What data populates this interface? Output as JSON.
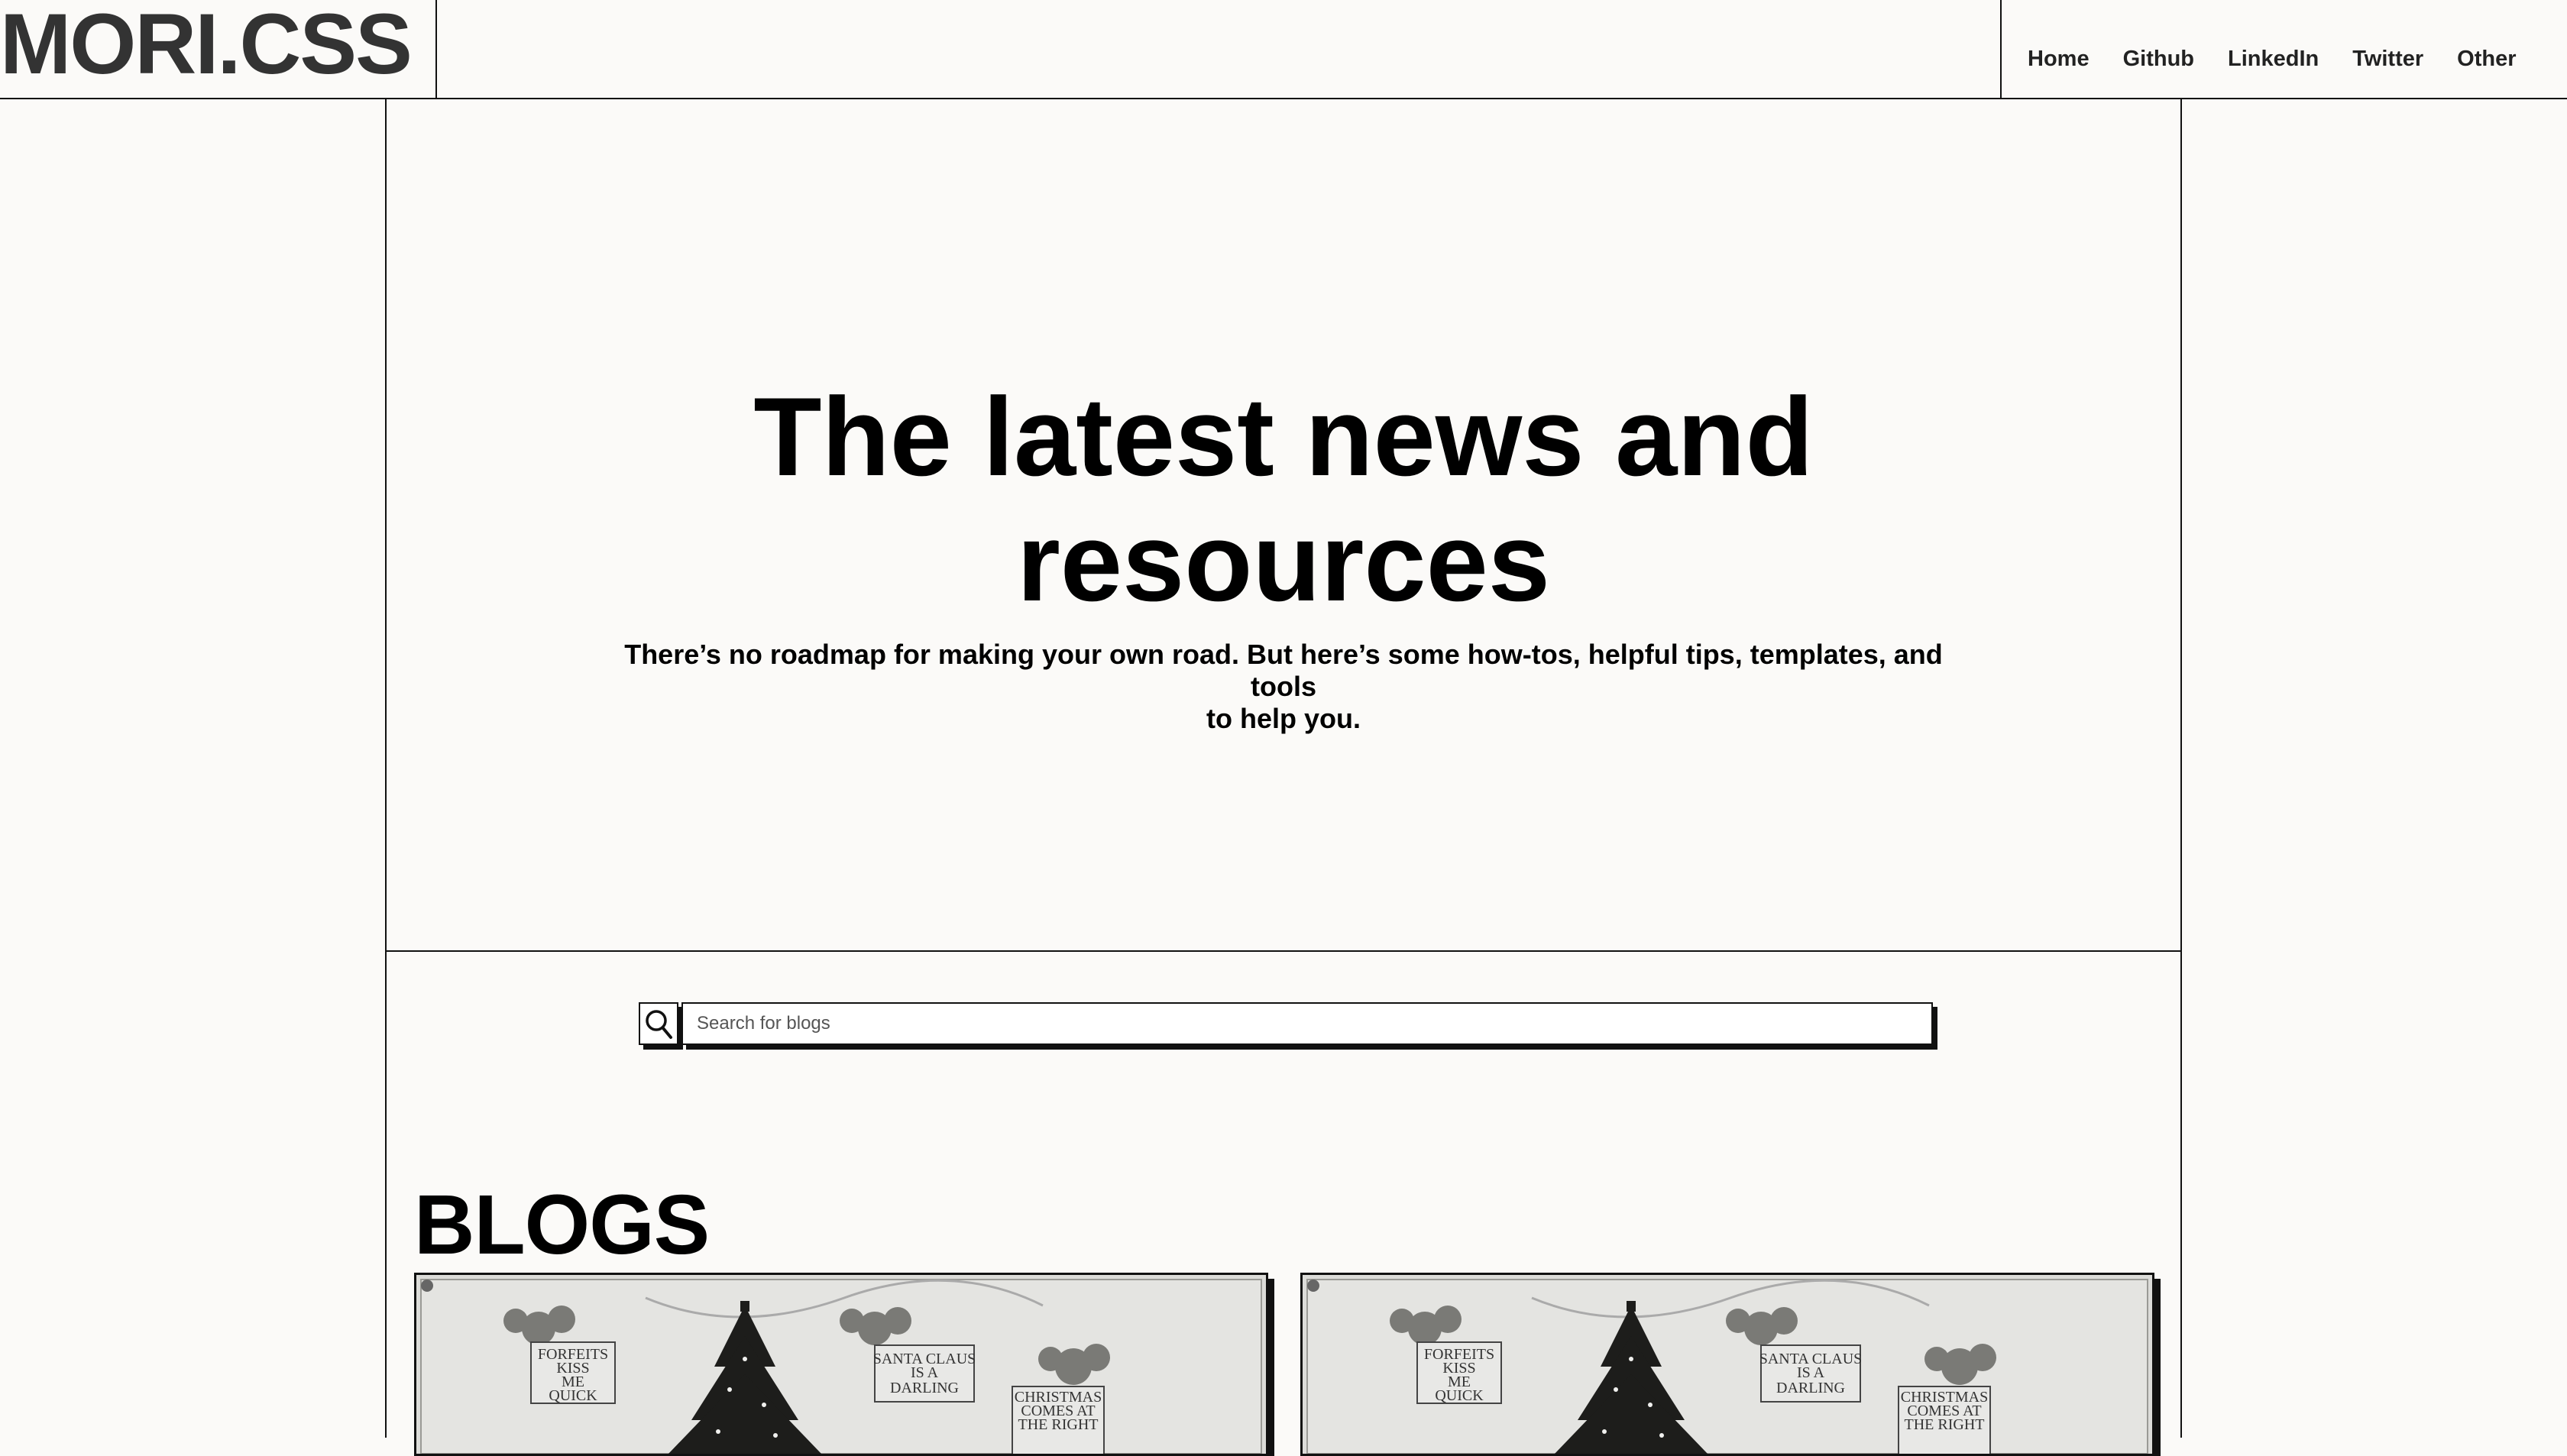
{
  "header": {
    "logo": "MORI.CSS",
    "nav": [
      {
        "label": "Home"
      },
      {
        "label": "Github"
      },
      {
        "label": "LinkedIn"
      },
      {
        "label": "Twitter"
      },
      {
        "label": "Other"
      }
    ]
  },
  "hero": {
    "title_line1": "The latest news and",
    "title_line2": "resources",
    "subtitle_line1": "There’s no roadmap for making your own road. But here’s some how-tos, helpful tips, templates, and tools",
    "subtitle_line2": "to help you."
  },
  "search": {
    "placeholder": "Search for blogs",
    "icon": "search-icon"
  },
  "blogs": {
    "title": "BLOGS",
    "cards": [
      {
        "image": "vintage-christmas-tree-illustration",
        "signs": [
          "FORFEITS",
          "KISS",
          "ME",
          "QUICK",
          "SANTA CLAUS",
          "IS A",
          "DARLING",
          "CHRISTMAS",
          "COMES AT",
          "THE RIGHT"
        ]
      },
      {
        "image": "vintage-christmas-tree-illustration",
        "signs": [
          "FORFEITS",
          "KISS",
          "ME",
          "QUICK",
          "SANTA CLAUS",
          "IS A",
          "DARLING",
          "CHRISTMAS",
          "COMES AT",
          "THE RIGHT"
        ]
      }
    ]
  },
  "colors": {
    "background": "#fbfaf8",
    "border": "#111111",
    "logo_text": "#333333"
  }
}
